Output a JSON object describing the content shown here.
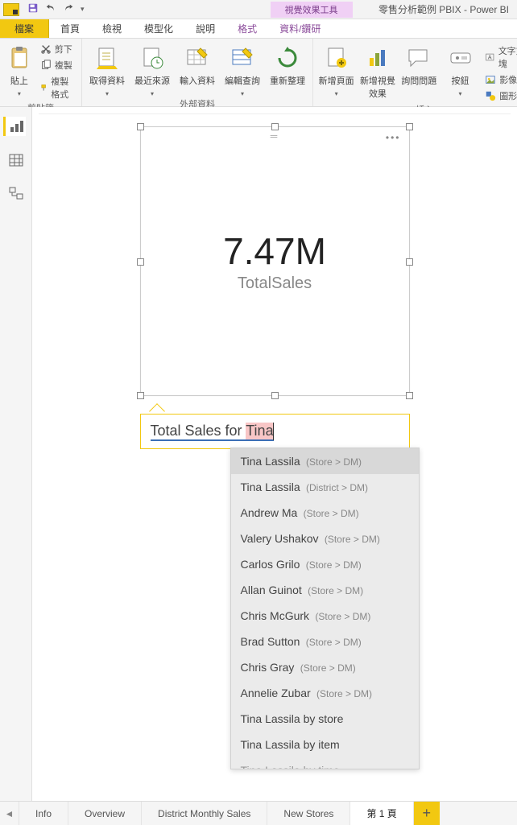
{
  "title": "零售分析範例 PBIX - Power BI",
  "contextual_tab": "視覺效果工具",
  "tabs": {
    "file": "檔案",
    "home": "首頁",
    "view": "檢視",
    "modeling": "模型化",
    "help": "說明",
    "format": "格式",
    "data": "資料/鑽研"
  },
  "ribbon": {
    "clipboard": {
      "label": "剪貼簿",
      "paste": "貼上",
      "cut": "剪下",
      "copy": "複製",
      "format_painter": "複製格式"
    },
    "external_data": {
      "label": "外部資料",
      "get_data": "取得資料",
      "recent": "最近來源",
      "enter": "輸入資料",
      "edit_queries": "編輯查詢",
      "refresh": "重新整理"
    },
    "insert": {
      "label": "插入",
      "new_page": "新增頁面",
      "new_visual": "新增視覺效果",
      "ask": "詢問問題",
      "buttons": "按鈕",
      "textbox": "文字方塊",
      "image": "影像",
      "shapes": "圖形"
    }
  },
  "visual": {
    "metric_value": "7.47M",
    "metric_label": "TotalSales"
  },
  "qna": {
    "prefix": "Total Sales for ",
    "typing": "Tina"
  },
  "suggestions": [
    {
      "name": "Tina Lassila",
      "scope": "(Store > DM)",
      "selected": true
    },
    {
      "name": "Tina Lassila",
      "scope": "(District > DM)"
    },
    {
      "name": "Andrew Ma",
      "scope": "(Store > DM)"
    },
    {
      "name": "Valery Ushakov",
      "scope": "(Store > DM)"
    },
    {
      "name": "Carlos Grilo",
      "scope": "(Store > DM)"
    },
    {
      "name": "Allan Guinot",
      "scope": "(Store > DM)"
    },
    {
      "name": "Chris McGurk",
      "scope": "(Store > DM)"
    },
    {
      "name": "Brad Sutton",
      "scope": "(Store > DM)"
    },
    {
      "name": "Chris Gray",
      "scope": "(Store > DM)"
    },
    {
      "name": "Annelie Zubar",
      "scope": "(Store > DM)"
    },
    {
      "name": "Tina Lassila by store",
      "scope": ""
    },
    {
      "name": "Tina Lassila by item",
      "scope": ""
    },
    {
      "name": "Tina Lassila by time",
      "scope": "",
      "cut": true
    }
  ],
  "pages": {
    "info": "Info",
    "overview": "Overview",
    "district": "District Monthly Sales",
    "newstores": "New Stores",
    "page1": "第 1 頁"
  }
}
